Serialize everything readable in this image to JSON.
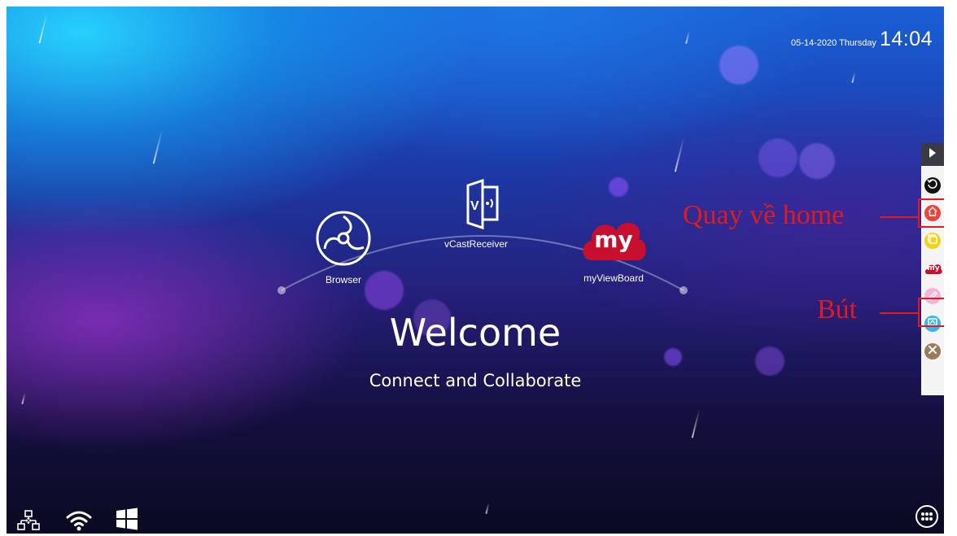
{
  "status": {
    "date": "05-14-2020 Thursday",
    "time": "14:04"
  },
  "apps": [
    {
      "label": "Browser",
      "icon": "browser-icon"
    },
    {
      "label": "vCastReceiver",
      "icon": "vcast-receiver-icon"
    },
    {
      "label": "myViewBoard",
      "icon": "myviewboard-icon",
      "logo_text": "my"
    }
  ],
  "welcome": {
    "title": "Welcome",
    "subtitle": "Connect and Collaborate"
  },
  "toolbar": {
    "items": [
      {
        "name": "back",
        "icon": "back-circle-icon",
        "color": "#111111"
      },
      {
        "name": "home",
        "icon": "home-icon",
        "color": "#e8453c"
      },
      {
        "name": "notes",
        "icon": "note-icon",
        "color": "#f3d21b"
      },
      {
        "name": "myviewboard",
        "icon": "myviewboard-small-icon",
        "color": "#c8102e",
        "logo_text": "my"
      },
      {
        "name": "pen",
        "icon": "pen-icon",
        "color": "#f6b3d8"
      },
      {
        "name": "screenshot",
        "icon": "screen-capture-icon",
        "color": "#39b5e6"
      },
      {
        "name": "settings",
        "icon": "tools-icon",
        "color": "#9a7b5d"
      }
    ]
  },
  "annotations": {
    "home": "Quay về home",
    "pen": "Bút"
  },
  "bottom_bar": {
    "left_icons": [
      "network-icon",
      "wifi-icon",
      "windows-icon"
    ],
    "right_icon": "app-drawer-icon"
  },
  "colors": {
    "accent_red": "#e01b1b",
    "myviewboard_red": "#c8102e"
  }
}
